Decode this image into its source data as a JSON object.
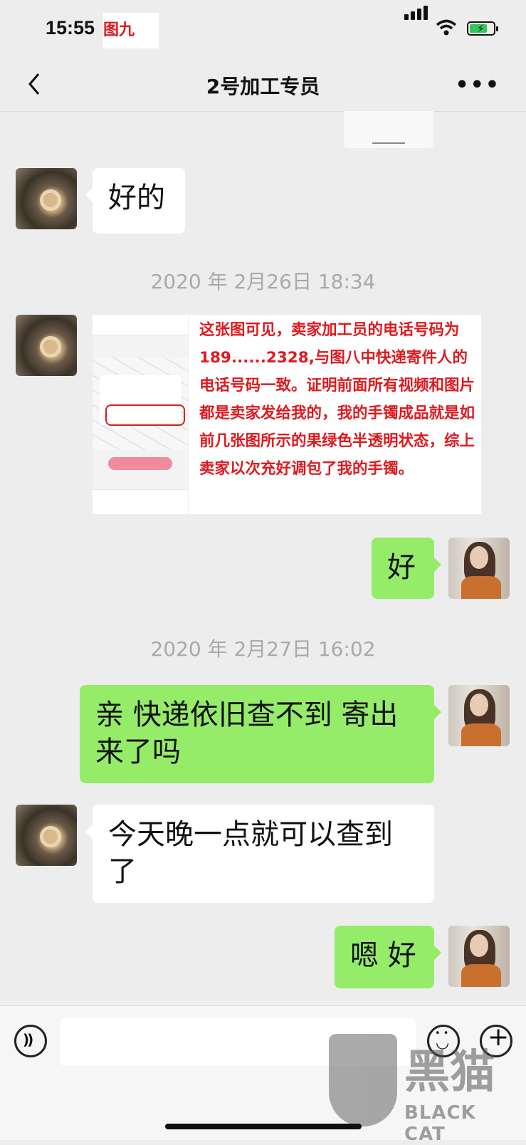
{
  "status_bar": {
    "time": "15:55",
    "figure_label": "图九"
  },
  "header": {
    "title": "2号加工专员"
  },
  "messages": {
    "m1": "好的",
    "ts1": "2020 年 2月26日 18:34",
    "m2_note": "这张图可见，卖家加工员的电话号码为 189......2328,与图八中快递寄件人的电话号码一致。证明前面所有视频和图片都是卖家发给我的，我的手镯成品就是如前几张图所示的果绿色半透明状态，综上卖家以次充好调包了我的手镯。",
    "m3": "好",
    "ts2": "2020 年 2月27日 16:02",
    "m4": "亲 快递依旧查不到 寄出来了吗",
    "m5": "今天晚一点就可以查到了",
    "m6": "嗯 好"
  },
  "watermark": {
    "cn": "黑猫",
    "en": "BLACK CAT"
  },
  "colors": {
    "sent_bubble": "#95ec69",
    "received_bubble": "#ffffff",
    "background": "#ededed",
    "annotation": "#e0191e"
  }
}
